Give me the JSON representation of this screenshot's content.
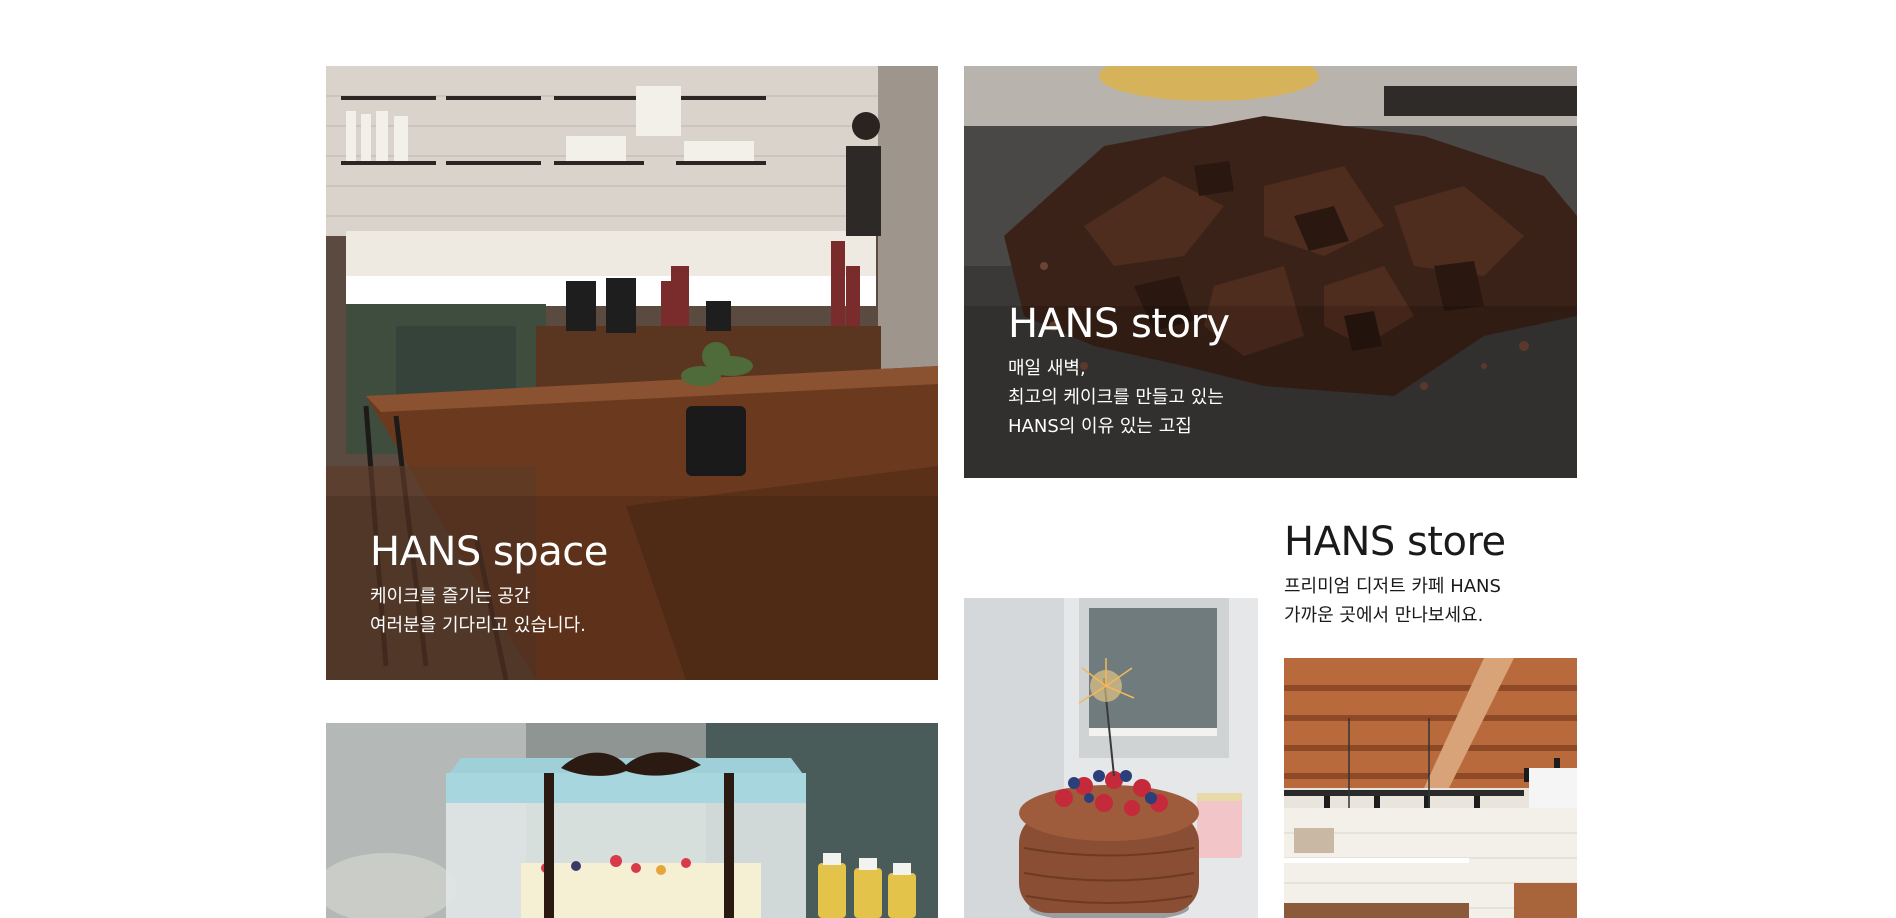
{
  "sections": {
    "space": {
      "title": "HANS space",
      "desc": "케이크를 즐기는 공간\n여러분을 기다리고 있습니다."
    },
    "story": {
      "title": "HANS story",
      "desc": "매일 새벽,\n최고의 케이크를 만들고 있는\nHANS의 이유 있는 고집"
    },
    "store": {
      "title": "HANS store",
      "desc": "프리미엄 디저트 카페 HANS\n가까운 곳에서 만나보세요."
    }
  },
  "colors": {
    "background": "#ffffff",
    "overlay_text": "#ffffff",
    "body_text": "#1a1a1a"
  }
}
